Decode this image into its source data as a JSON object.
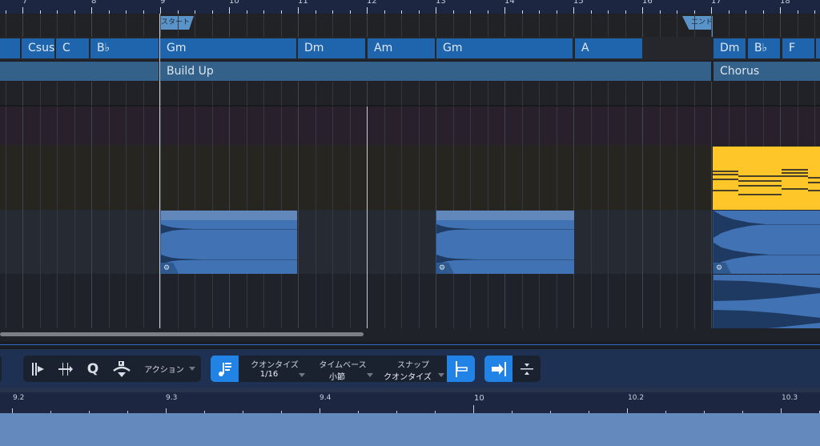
{
  "ruler": {
    "bars": [
      "7",
      "8",
      "9",
      "10",
      "11",
      "12",
      "13",
      "14",
      "15",
      "16",
      "17",
      "18"
    ]
  },
  "markers": {
    "start": "スタート",
    "end": "エンド"
  },
  "chords": [
    "",
    "Csus",
    "C",
    "B♭",
    "Gm",
    "Dm",
    "Am",
    "Gm",
    "A",
    "Dm",
    "B♭",
    "F"
  ],
  "sections": [
    "",
    "Build Up",
    "Chorus"
  ],
  "clips": {
    "gear_icon": "⚙"
  },
  "toolbar": {
    "action_label": "アクション",
    "quantize": {
      "title": "クオンタイズ",
      "value": "1/16"
    },
    "timebase": {
      "title": "タイムベース",
      "value": "小節"
    },
    "snap": {
      "title": "スナップ",
      "value": "クオンタイズ"
    }
  },
  "lower_ruler": {
    "labels": [
      "9.2",
      "9.3",
      "9.4",
      "10",
      "10.2",
      "10.3"
    ]
  },
  "colors": {
    "chord": "#1f65ad",
    "section": "#336189",
    "audio_clip": "#4072b4",
    "midi_clip": "#ffc629",
    "accent": "#2283e6"
  }
}
